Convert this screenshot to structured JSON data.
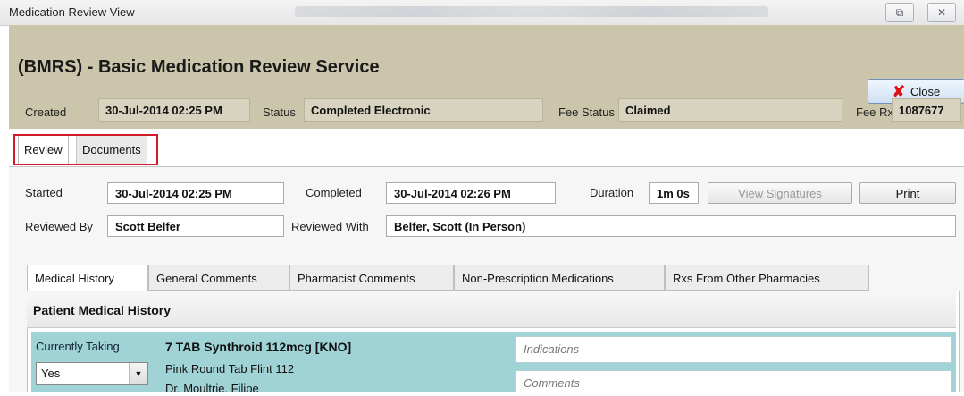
{
  "window": {
    "title": "Medication Review View",
    "restore_glyph": "⧉",
    "close_glyph": "✕"
  },
  "header": {
    "heading": "(BMRS) - Basic Medication Review Service",
    "close_button": {
      "label": "Close",
      "icon": "red-x-icon"
    },
    "created_label": "Created",
    "created_value": "30-Jul-2014 02:25 PM",
    "status_label": "Status",
    "status_value": "Completed Electronic",
    "fee_status_label": "Fee Status",
    "fee_status_value": "Claimed",
    "fee_rx_label": "Fee Rx",
    "fee_rx_value": "1087677"
  },
  "tabs": [
    {
      "label": "Review",
      "active": true
    },
    {
      "label": "Documents",
      "active": false
    }
  ],
  "review": {
    "started_label": "Started",
    "started_value": "30-Jul-2014 02:25 PM",
    "completed_label": "Completed",
    "completed_value": "30-Jul-2014 02:26 PM",
    "duration_label": "Duration",
    "duration_value": "1m 0s",
    "view_signatures_label": "View Signatures",
    "print_label": "Print",
    "reviewed_by_label": "Reviewed By",
    "reviewed_by_value": "Scott Belfer",
    "reviewed_with_label": "Reviewed With",
    "reviewed_with_value": "Belfer, Scott (In Person)"
  },
  "subtabs": [
    {
      "label": "Medical History",
      "active": true
    },
    {
      "label": "General Comments",
      "active": false
    },
    {
      "label": "Pharmacist Comments",
      "active": false
    },
    {
      "label": "Non-Prescription Medications",
      "active": false
    },
    {
      "label": "Rxs From Other Pharmacies",
      "active": false
    }
  ],
  "medical_history": {
    "section_title": "Patient Medical History",
    "currently_taking_label": "Currently Taking",
    "currently_taking_value": "Yes",
    "medication_name": "7 TAB Synthroid 112mcg [KNO]",
    "medication_description": "Pink Round Tab Flint 112",
    "prescriber": "Dr. Moultrie, Filipe",
    "indications_placeholder": "Indications",
    "comments_placeholder": "Comments"
  },
  "colors": {
    "header_bg": "#cbc6ab",
    "highlight_border": "#d11a2a",
    "medication_row_bg": "#9fd3d6"
  }
}
